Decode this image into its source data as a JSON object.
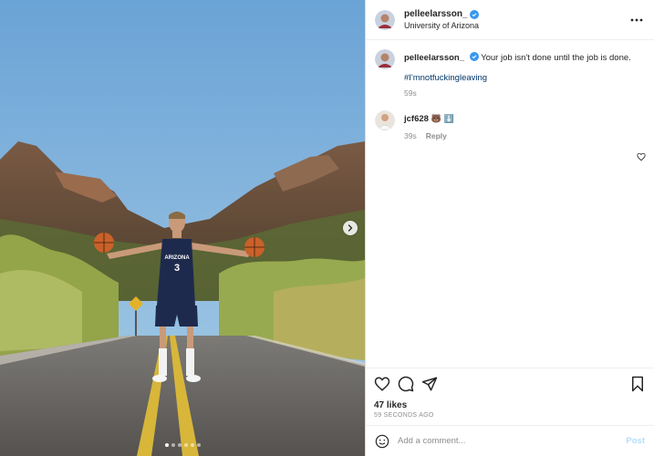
{
  "post": {
    "media": {
      "alt_icon_next": "chevron-right-icon",
      "carousel": {
        "count": 6,
        "active_index": 0
      }
    },
    "header": {
      "username": "pelleelarsson_",
      "verified": true,
      "location": "University of Arizona",
      "more_icon": "more-horizontal-icon"
    },
    "caption": {
      "username": "pelleelarsson_",
      "text": "Your job isn't done until the job is done.",
      "hashtag": "#I'mnotfuckingleaving",
      "time": "59s"
    },
    "comments": [
      {
        "username": "jcf628",
        "text": "🐻 ⬇️",
        "time": "39s",
        "reply_label": "Reply",
        "like_icon": "heart-icon"
      }
    ],
    "actions": {
      "icons": [
        "heart-icon",
        "comment-icon",
        "share-icon",
        "bookmark-icon"
      ],
      "likes": "47 likes",
      "timestamp": "59 SECONDS AGO"
    },
    "add_comment": {
      "placeholder": "Add a comment...",
      "post_label": "Post",
      "emoji_icon": "smiley-icon"
    }
  },
  "colors": {
    "link": "#00376b",
    "verified": "#3897f0",
    "post_disabled": "#b2dffc",
    "muted": "#8e8e8e"
  }
}
